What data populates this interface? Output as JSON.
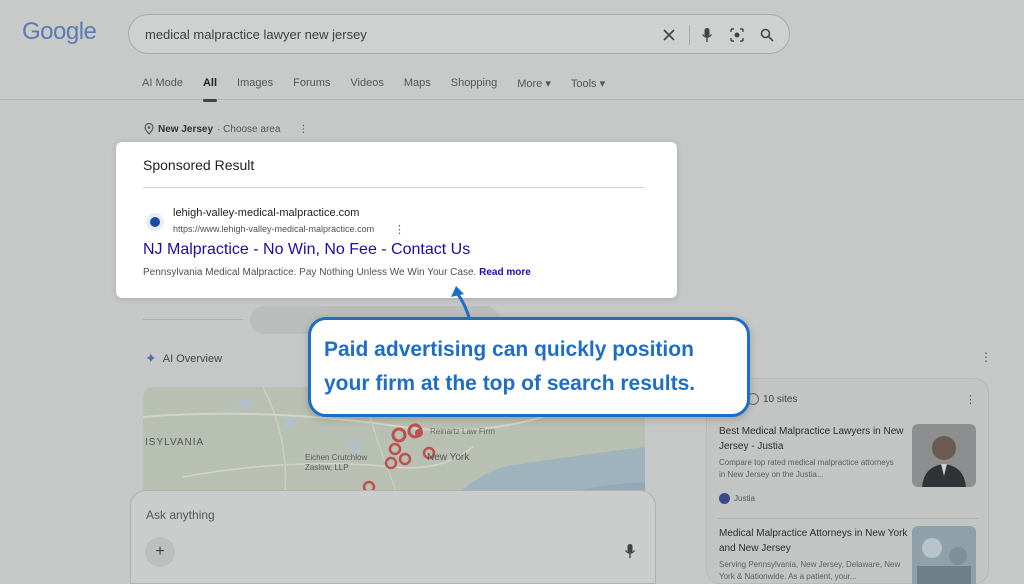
{
  "header": {
    "logo": "Google",
    "search_query": "medical malpractice lawyer new jersey",
    "icons": [
      "close-icon",
      "mic-icon",
      "lens-icon",
      "search-icon"
    ],
    "tabs": [
      {
        "label": "AI Mode",
        "active": false
      },
      {
        "label": "All",
        "active": true
      },
      {
        "label": "Images",
        "active": false
      },
      {
        "label": "Forums",
        "active": false
      },
      {
        "label": "Videos",
        "active": false
      },
      {
        "label": "Maps",
        "active": false
      },
      {
        "label": "Shopping",
        "active": false
      },
      {
        "label": "More ▾",
        "active": false
      },
      {
        "label": "Tools ▾",
        "active": false
      }
    ]
  },
  "location": {
    "region": "New Jersey",
    "action": "· Choose area"
  },
  "sponsored": {
    "heading": "Sponsored Result",
    "domain": "lehigh-valley-medical-malpractice.com",
    "url": "https://www.lehigh-valley-medical-malpractice.com",
    "title": "NJ Malpractice - No Win, No Fee - Contact Us",
    "description": "Pennsylvania Medical Malpractice. Pay Nothing Unless We Win Your Case.",
    "read_more": "Read more"
  },
  "ai_overview": {
    "label": "AI Overview"
  },
  "map": {
    "labels": [
      "ISYLVANIA",
      "Reinartz Law Firm",
      "Eichen Crutchlow Zaslow, LLP",
      "New York"
    ]
  },
  "ask": {
    "placeholder": "Ask anything",
    "plus": "+"
  },
  "sources": {
    "count": "10 sites",
    "items": [
      {
        "title": "Best Medical Malpractice Lawyers in New Jersey - Justia",
        "desc": "Compare top rated medical malpractice attorneys in New Jersey on the Justia...",
        "source": "Justia"
      },
      {
        "title": "Medical Malpractice Attorneys in New York and New Jersey",
        "desc": "Serving Pennsylvania, New Jersey, Delaware, New York & Nationwide. As a patient, your..."
      }
    ]
  },
  "callout": {
    "text": "Paid advertising can quickly position your firm at the top of search results."
  },
  "colors": {
    "callout_blue": "#1e6ec6",
    "ad_link": "#1a0dab"
  }
}
